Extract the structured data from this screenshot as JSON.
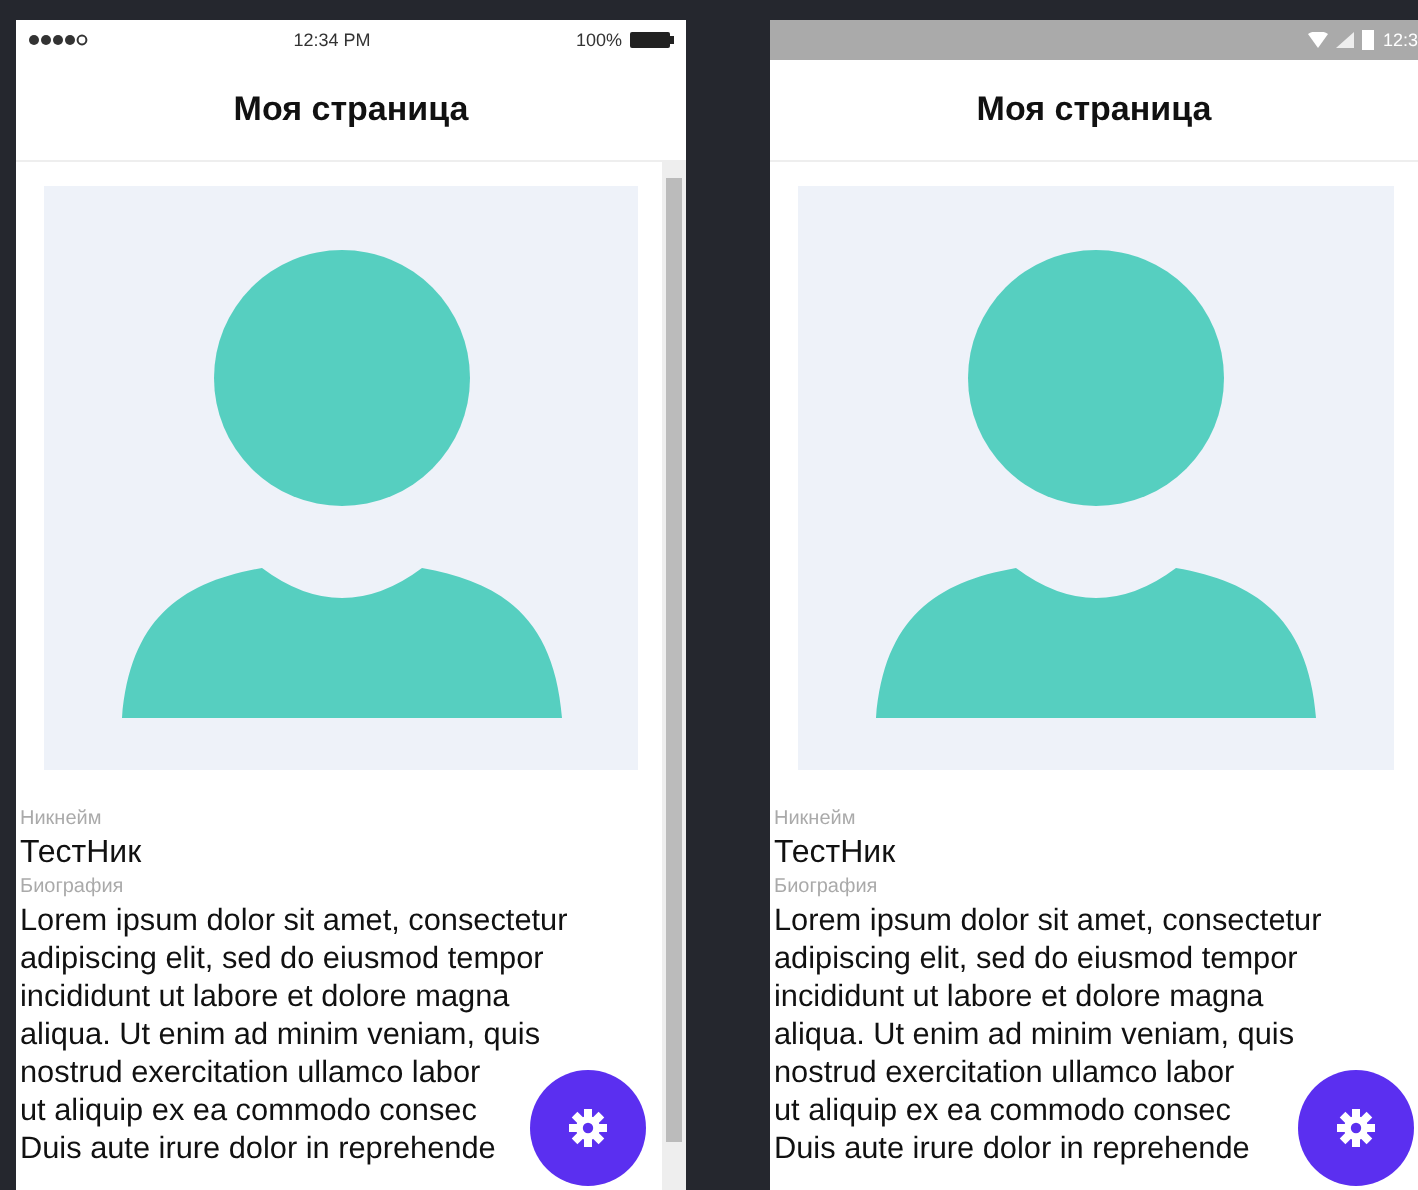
{
  "screens": [
    {
      "status_bar": {
        "kind": "ios",
        "time": "12:34 PM",
        "battery": "100%"
      },
      "title": "Моя страница",
      "fields": [
        {
          "label": "Никнейм",
          "lines": [
            "ТестНик"
          ],
          "kind": "value"
        },
        {
          "label": "Биография",
          "lines": [
            "Lorem ipsum dolor sit amet, consectetur",
            "adipiscing elit, sed do eiusmod tempor",
            "incididunt ut labore et dolore magna",
            "aliqua. Ut enim ad minim veniam, quis",
            "nostrud exercitation ullamco labor",
            "ut aliquip ex ea commodo consec",
            "Duis aute irure dolor in reprehende"
          ],
          "kind": "text"
        }
      ]
    },
    {
      "status_bar": {
        "kind": "android",
        "time": "12:3"
      },
      "title": "Моя страница",
      "fields": [
        {
          "label": "Никнейм",
          "lines": [
            "ТестНик"
          ],
          "kind": "value"
        },
        {
          "label": "Биография",
          "lines": [
            "Lorem ipsum dolor sit amet, consectetur",
            "adipiscing elit, sed do eiusmod tempor",
            "incididunt ut labore et dolore magna",
            "aliqua. Ut enim ad minim veniam, quis",
            "nostrud exercitation ullamco labor",
            "ut aliquip ex ea commodo consec",
            "Duis aute irure dolor in reprehende"
          ],
          "kind": "text"
        }
      ]
    }
  ]
}
